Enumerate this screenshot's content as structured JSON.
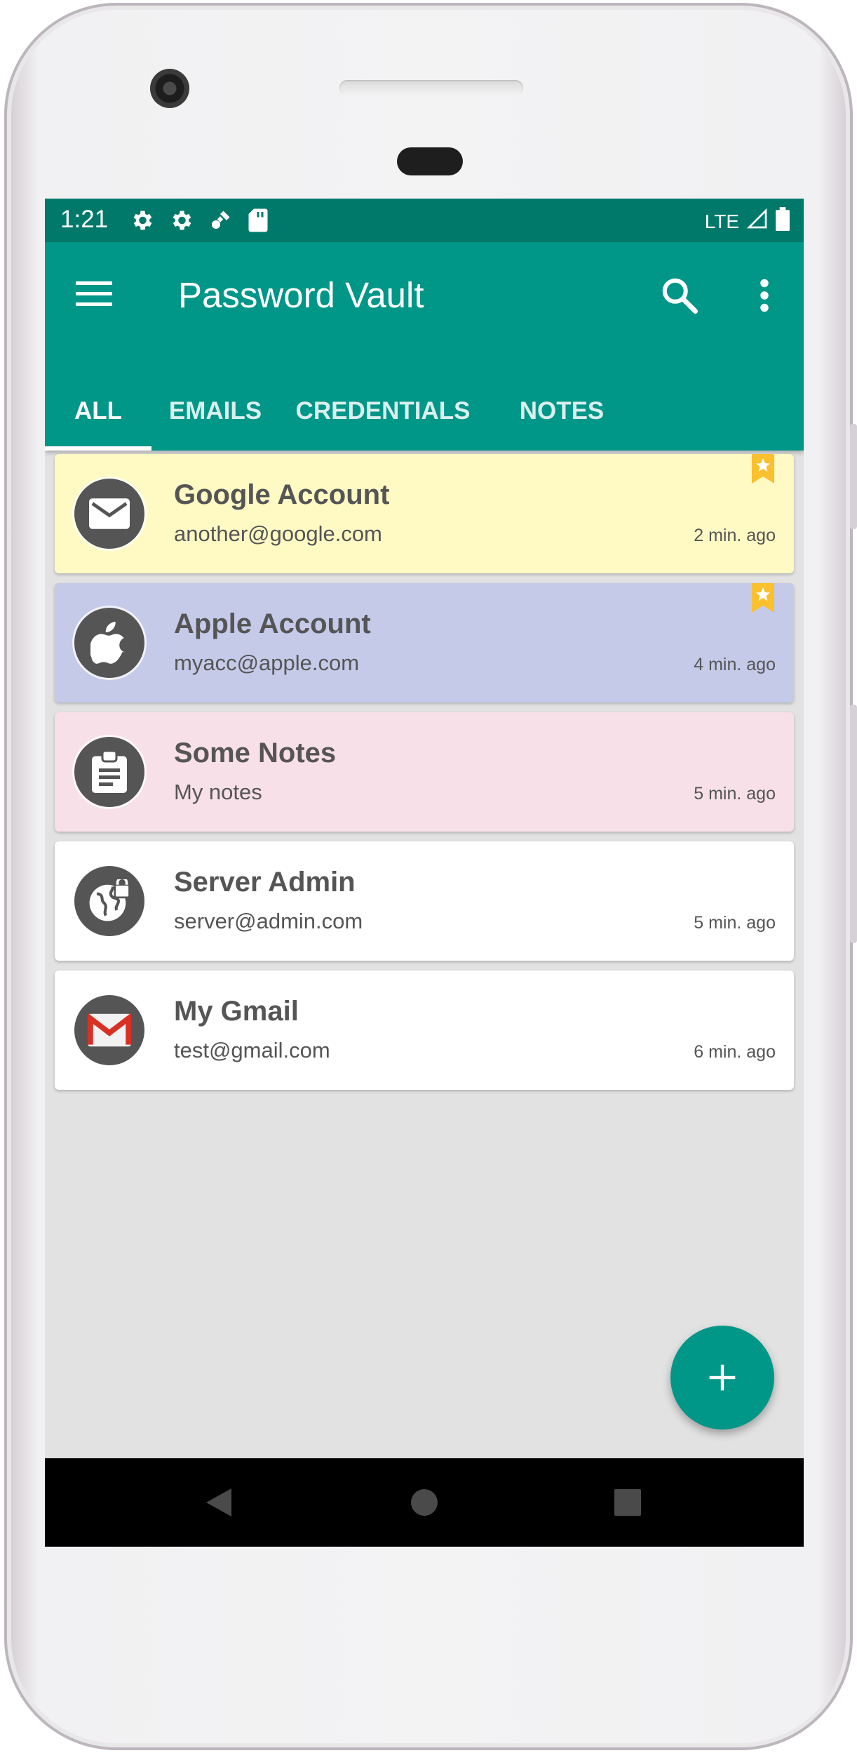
{
  "status_bar": {
    "time": "1:21",
    "network": "LTE",
    "icons": [
      "settings-icon",
      "settings-icon",
      "satellite-icon",
      "sd-card-icon",
      "signal-icon",
      "battery-icon"
    ]
  },
  "app_bar": {
    "title": "Password Vault",
    "menu_icon": "menu-icon",
    "search_icon": "search-icon",
    "more_icon": "more-vert-icon",
    "color": "#009688",
    "status_color": "#00796b"
  },
  "tabs": [
    {
      "label": "ALL",
      "selected": true
    },
    {
      "label": "EMAILS",
      "selected": false
    },
    {
      "label": "CREDENTIALS",
      "selected": false
    },
    {
      "label": "NOTES",
      "selected": false
    }
  ],
  "entries": [
    {
      "name": "Google Account",
      "detail": "another@google.com",
      "time": "2 min. ago",
      "icon": "email-icon",
      "color": "#fff9c4",
      "starred": true
    },
    {
      "name": "Apple Account",
      "detail": "myacc@apple.com",
      "time": "4 min. ago",
      "icon": "apple-icon",
      "color": "#c5cae9",
      "starred": true
    },
    {
      "name": "Some Notes",
      "detail": "My notes",
      "time": "5 min. ago",
      "icon": "clipboard-icon",
      "color": "#f8e0e8",
      "starred": false
    },
    {
      "name": "Server Admin",
      "detail": "server@admin.com",
      "time": "5 min. ago",
      "icon": "globe-lock-icon",
      "color": "#ffffff",
      "starred": false
    },
    {
      "name": "My Gmail",
      "detail": "test@gmail.com",
      "time": "6 min. ago",
      "icon": "gmail-icon",
      "color": "#ffffff",
      "starred": false
    }
  ],
  "fab": {
    "icon": "plus-icon"
  },
  "nav_bar": {
    "icons": [
      "back-icon",
      "home-icon",
      "recents-icon"
    ]
  }
}
